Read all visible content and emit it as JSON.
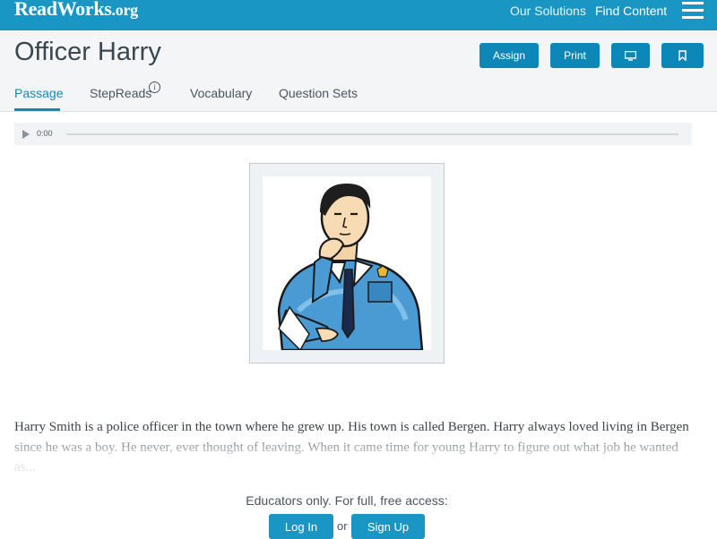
{
  "brand": {
    "logo_main": "ReadWorks",
    "logo_suffix": ".org",
    "accent": "#1996c4"
  },
  "topnav": {
    "solutions": "Our Solutions",
    "find_content": "Find Content",
    "menu_icon": "hamburger-menu-icon"
  },
  "article": {
    "title": "Officer Harry"
  },
  "actions": {
    "assign": "Assign",
    "print": "Print",
    "present_icon": "monitor-icon",
    "bookmark_icon": "bookmark-icon"
  },
  "tabs": [
    {
      "label": "Passage",
      "active": true
    },
    {
      "label": "StepReads",
      "info": "i"
    },
    {
      "label": "Vocabulary"
    },
    {
      "label": "Question Sets"
    }
  ],
  "audio": {
    "time": "0:00",
    "play_icon": "play-icon"
  },
  "illustration": {
    "subject": "police-officer-illustration"
  },
  "passage": {
    "text": "Harry Smith is a police officer in the town where he grew up. His town is called Bergen. Harry always loved living in Bergen since he was a boy. He never, ever thought of leaving. When it came time for young Harry to figure out what job he wanted as..."
  },
  "access": {
    "prompt": "Educators only. For full, free access:",
    "login": "Log In",
    "or": "or",
    "signup": "Sign Up"
  }
}
